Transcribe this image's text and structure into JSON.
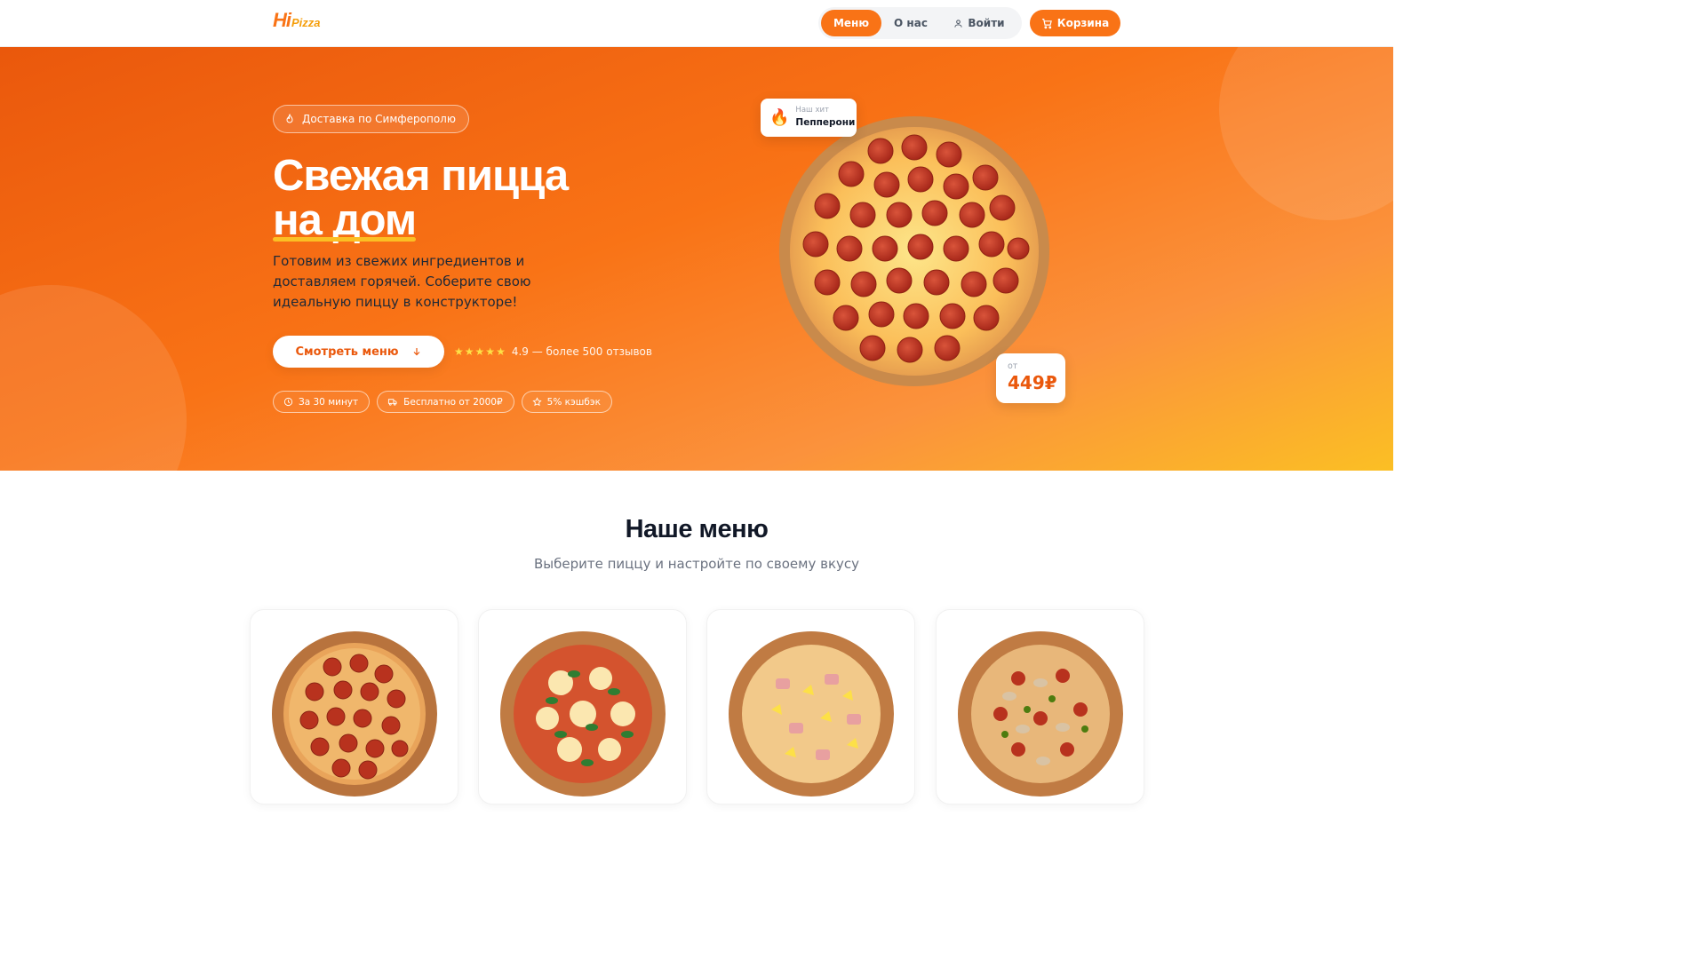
{
  "header": {
    "logo": {
      "hi": "Hi",
      "pizza": "Pizza"
    },
    "nav": [
      {
        "label": "Меню",
        "active": true
      },
      {
        "label": "О нас",
        "active": false
      },
      {
        "label": "Войти",
        "active": false,
        "icon": "user-icon"
      }
    ],
    "cart_label": "Корзина",
    "cart_icon": "cart-icon"
  },
  "hero": {
    "badge": "Доставка по Симферополю",
    "title_line1": "Свежая пицца",
    "title_line2": "на дом",
    "description": "Готовим из свежих ингредиентов и доставляем горячей. Соберите свою идеальную пиццу в конструкторе!",
    "cta_label": "Смотреть меню",
    "rating_stars": 5,
    "rating_text": "4.9 — более 500 отзывов",
    "chips": [
      {
        "label": "За 30 минут",
        "icon": "clock-icon"
      },
      {
        "label": "Бесплатно от 2000₽",
        "icon": "truck-icon"
      },
      {
        "label": "5% кэшбэк",
        "icon": "star-icon"
      }
    ],
    "hit_small": "Наш хит",
    "hit_name": "Пепперони",
    "price_from": "от",
    "price_value": "449₽"
  },
  "menu": {
    "title": "Наше меню",
    "subtitle": "Выберите пиццу и настройте по своему вкусу",
    "cards": [
      {
        "image": "pepperoni-pizza-image"
      },
      {
        "image": "margherita-pizza-image"
      },
      {
        "image": "hawaiian-pizza-image"
      },
      {
        "image": "meat-mushroom-pizza-image"
      }
    ]
  },
  "colors": {
    "accent": "#f97316",
    "accent_dark": "#ea580c",
    "underline": "#fbbf24"
  }
}
